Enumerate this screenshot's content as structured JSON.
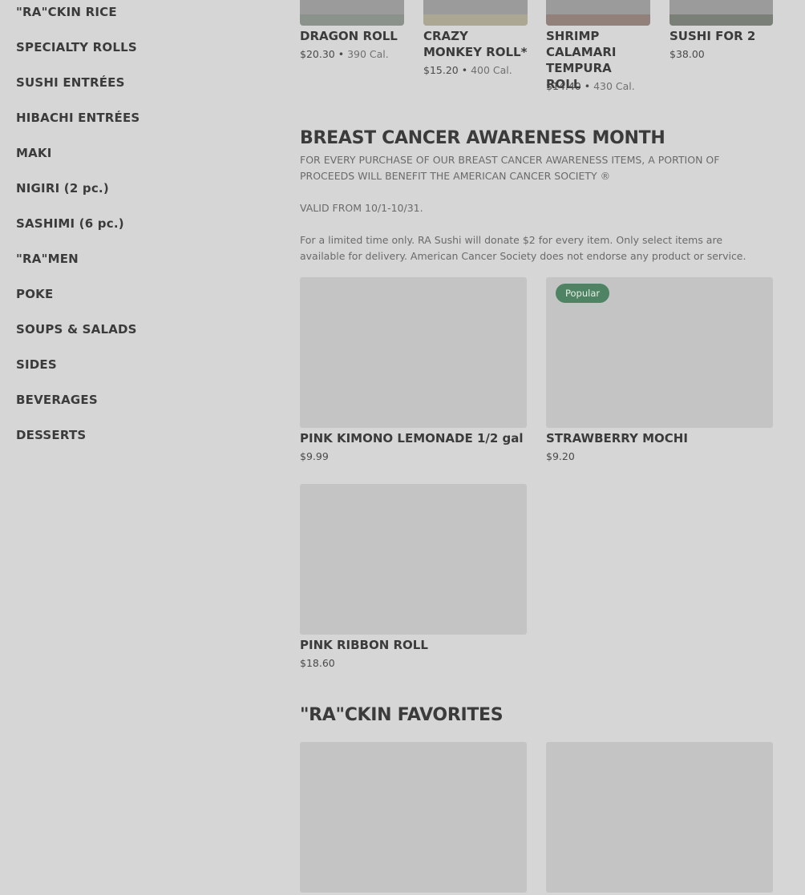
{
  "sidebar": {
    "items": [
      {
        "label": "\"RA\"CKIN RICE"
      },
      {
        "label": "SPECIALTY ROLLS"
      },
      {
        "label": "SUSHI ENTRÉES"
      },
      {
        "label": "HIBACHI ENTRÉES"
      },
      {
        "label": "MAKI"
      },
      {
        "label": "NIGIRI (2 pc.)"
      },
      {
        "label": "SASHIMI (6 pc.)"
      },
      {
        "label": "\"RA\"MEN"
      },
      {
        "label": "POKE"
      },
      {
        "label": "SOUPS & SALADS"
      },
      {
        "label": "SIDES"
      },
      {
        "label": "BEVERAGES"
      },
      {
        "label": "DESSERTS"
      }
    ]
  },
  "top_items": [
    {
      "name": "DRAGON ROLL",
      "price": "$20.30",
      "cal": "390 Cal."
    },
    {
      "name": "CRAZY MONKEY ROLL*",
      "price": "$15.20",
      "cal": "400 Cal."
    },
    {
      "name": "SHRIMP CALAMARI TEMPURA ROLL",
      "price": "$14.40",
      "cal": "430 Cal."
    },
    {
      "name": "SUSHI FOR 2",
      "price": "$38.00",
      "cal": ""
    }
  ],
  "bcam": {
    "title": "BREAST CANCER AWARENESS MONTH",
    "desc1": "FOR EVERY PURCHASE OF OUR BREAST CANCER AWARENESS ITEMS, A PORTION OF PROCEEDS WILL BENEFIT THE AMERICAN CANCER SOCIETY ®",
    "desc2": "VALID FROM 10/1-10/31.",
    "desc3": "For a limited time only. RA Sushi will donate $2 for every item. Only select items are available for delivery. American Cancer Society does not endorse any product or service.",
    "items": [
      {
        "name": "PINK KIMONO LEMONADE 1/2 gal",
        "price": "$9.99",
        "badge": ""
      },
      {
        "name": "STRAWBERRY MOCHI",
        "price": "$9.20",
        "badge": "Popular"
      },
      {
        "name": "PINK RIBBON ROLL",
        "price": "$18.60",
        "badge": ""
      }
    ]
  },
  "favorites": {
    "title": "\"RA\"CKIN FAVORITES"
  },
  "colors": {
    "overlay_bg": "#d6d6d6",
    "badge_green": "#4e8463"
  }
}
